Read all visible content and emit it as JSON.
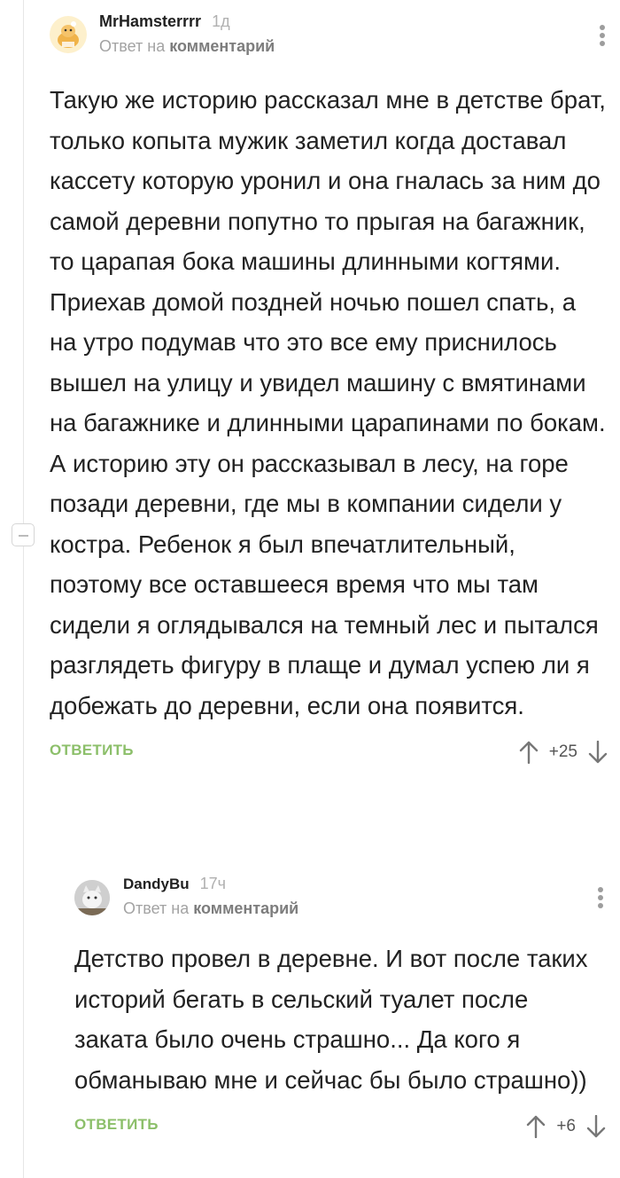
{
  "comments": [
    {
      "author": "MrHamsterrrr",
      "time": "1д",
      "reply_prefix": "Ответ на",
      "reply_link": "комментарий",
      "text": "Такую же историю рассказал мне в детстве брат, только копыта мужик заметил когда доставал кассету которую уронил и она гналась за ним до самой деревни попутно то прыгая на багажник, то царапая бока машины длинными когтями. Приехав домой поздней ночью пошел спать, а на утро подумав что это все ему приснилось вышел на улицу и увидел машину с вмятинами на багажнике и длинными царапинами по бокам. А историю эту он рассказывал в лесу, на горе позади деревни, где мы в компании сидели у костра. Ребенок я был впечатлительный, поэтому все оставшееся время что мы там сидели я оглядывался на темный лес и пытался разглядеть фигуру в плаще и думал успею ли я добежать до деревни, если она появится.",
      "reply_label": "ОТВЕТИТЬ",
      "score": "+25"
    },
    {
      "author": "DandyBu",
      "time": "17ч",
      "reply_prefix": "Ответ на",
      "reply_link": "комментарий",
      "text": "Детство провел в деревне. И вот после таких историй бегать в сельский туалет после заката было очень страшно... Да кого я обманываю мне и сейчас бы было страшно))",
      "reply_label": "ОТВЕТИТЬ",
      "score": "+6"
    }
  ],
  "colors": {
    "accent_green": "#8cbf6a",
    "muted": "#a3a3a3",
    "text": "#222222"
  }
}
